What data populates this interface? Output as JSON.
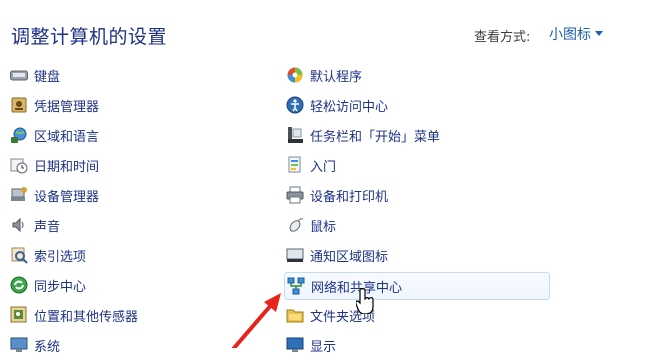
{
  "header": {
    "title": "调整计算机的设置",
    "view_by_label": "查看方式:",
    "view_by_value": "小图标"
  },
  "left_column": [
    {
      "label": "键盘",
      "icon": "keyboard-icon"
    },
    {
      "label": "凭据管理器",
      "icon": "credential-manager-icon"
    },
    {
      "label": "区域和语言",
      "icon": "region-language-icon"
    },
    {
      "label": "日期和时间",
      "icon": "date-time-icon"
    },
    {
      "label": "设备管理器",
      "icon": "device-manager-icon"
    },
    {
      "label": "声音",
      "icon": "sound-icon"
    },
    {
      "label": "索引选项",
      "icon": "indexing-options-icon"
    },
    {
      "label": "同步中心",
      "icon": "sync-center-icon"
    },
    {
      "label": "位置和其他传感器",
      "icon": "location-sensors-icon"
    },
    {
      "label": "系统",
      "icon": "system-icon"
    }
  ],
  "right_column": [
    {
      "label": "默认程序",
      "icon": "default-programs-icon"
    },
    {
      "label": "轻松访问中心",
      "icon": "ease-of-access-icon"
    },
    {
      "label": "任务栏和「开始」菜单",
      "icon": "taskbar-start-menu-icon"
    },
    {
      "label": "入门",
      "icon": "getting-started-icon"
    },
    {
      "label": "设备和打印机",
      "icon": "devices-printers-icon"
    },
    {
      "label": "鼠标",
      "icon": "mouse-icon"
    },
    {
      "label": "通知区域图标",
      "icon": "notification-area-icon"
    },
    {
      "label": "网络和共享中心",
      "icon": "network-sharing-icon"
    },
    {
      "label": "文件夹选项",
      "icon": "folder-options-icon"
    },
    {
      "label": "显示",
      "icon": "display-icon"
    }
  ],
  "annotation": {
    "arrow_color": "#e8231c"
  }
}
